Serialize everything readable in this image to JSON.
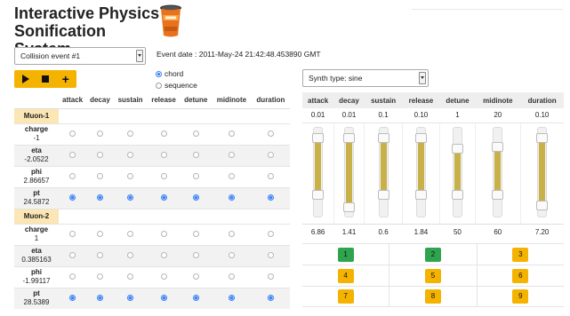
{
  "header": {
    "title": "Interactive Physics Sonification System"
  },
  "collision_select": {
    "value": "Collision event #1"
  },
  "event_date": "Event date : 2011-May-24 21:42:48.453890 GMT",
  "playback": {
    "play": "play-icon",
    "stop": "stop-icon",
    "add": "plus-icon"
  },
  "mode": {
    "chord": "chord",
    "sequence": "sequence",
    "selected": "chord"
  },
  "synth_select": {
    "value": "Synth type: sine"
  },
  "params": [
    "attack",
    "decay",
    "sustain",
    "release",
    "detune",
    "midinote",
    "duration"
  ],
  "particles": [
    {
      "name": "Muon-1",
      "rows": [
        {
          "label": "charge",
          "value": "-1",
          "selected": false
        },
        {
          "label": "eta",
          "value": "-2.0522",
          "selected": false
        },
        {
          "label": "phi",
          "value": "2.86657",
          "selected": false
        },
        {
          "label": "pt",
          "value": "24.5872",
          "selected": true
        }
      ]
    },
    {
      "name": "Muon-2",
      "rows": [
        {
          "label": "charge",
          "value": "1",
          "selected": false
        },
        {
          "label": "eta",
          "value": "0.385163",
          "selected": false
        },
        {
          "label": "phi",
          "value": "-1.99117",
          "selected": false
        },
        {
          "label": "pt",
          "value": "28.5389",
          "selected": true
        }
      ]
    }
  ],
  "synth": {
    "min_values": [
      "0.01",
      "0.01",
      "0.1",
      "0.10",
      "1",
      "20",
      "0.10"
    ],
    "max_values": [
      "6.86",
      "1.41",
      "0.6",
      "1.84",
      "50",
      "60",
      "7.20"
    ],
    "sliders": [
      {
        "low": 0.24,
        "high": 0.88
      },
      {
        "low": 0.1,
        "high": 0.88
      },
      {
        "low": 0.24,
        "high": 0.88
      },
      {
        "low": 0.24,
        "high": 0.88
      },
      {
        "low": 0.24,
        "high": 0.76
      },
      {
        "low": 0.24,
        "high": 0.78
      },
      {
        "low": 0.12,
        "high": 0.88
      }
    ],
    "fill_color": "#c9b14a"
  },
  "pads": [
    {
      "label": "1",
      "color": "#2ea44f"
    },
    {
      "label": "2",
      "color": "#2ea44f"
    },
    {
      "label": "3",
      "color": "#f5b301"
    },
    {
      "label": "4",
      "color": "#f5b301"
    },
    {
      "label": "5",
      "color": "#f5b301"
    },
    {
      "label": "6",
      "color": "#f5b301"
    },
    {
      "label": "7",
      "color": "#f5b301"
    },
    {
      "label": "8",
      "color": "#f5b301"
    },
    {
      "label": "9",
      "color": "#f5b301"
    }
  ],
  "colors": {
    "accent": "#f5b301",
    "radio_on": "#3b82f6",
    "section_bg": "#fbe6b4"
  }
}
